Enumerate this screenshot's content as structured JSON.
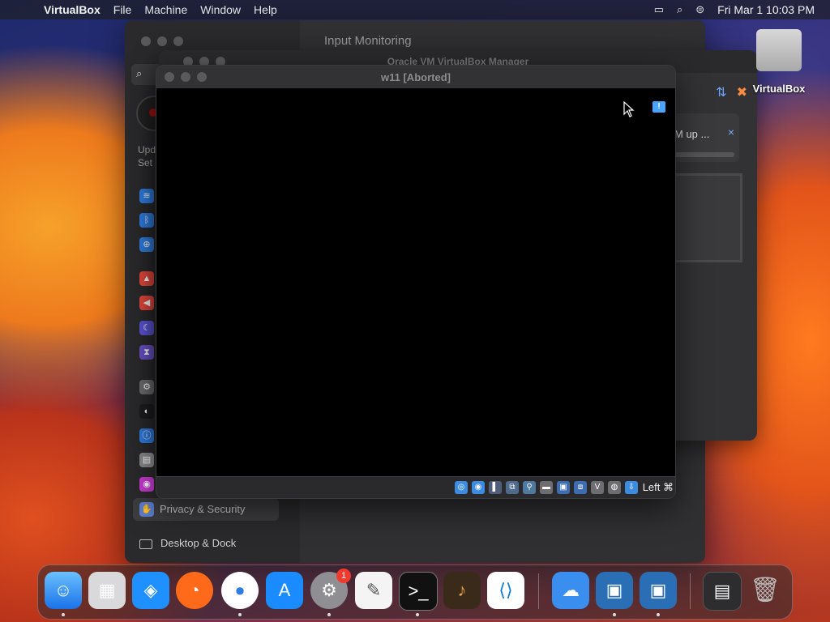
{
  "menubar": {
    "app_name": "VirtualBox",
    "menus": [
      "File",
      "Machine",
      "Window",
      "Help"
    ],
    "clock": "Fri Mar 1  10:03 PM"
  },
  "settings_window": {
    "main_title": "Input Monitoring",
    "account_text_line1": "Upd",
    "account_text_line2": "Set",
    "selected_item": "Privacy & Security",
    "next_item": "Desktop & Dock"
  },
  "manager_window": {
    "title": "Oracle VM VirtualBox Manager",
    "notice_text": "M up ...",
    "notice_close": "×"
  },
  "vm_window": {
    "title": "w11 [Aborted]",
    "host_key": "Left ⌘"
  },
  "desktop": {
    "drive_label": "VirtualBox"
  },
  "dock": {
    "settings_badge": "1"
  }
}
